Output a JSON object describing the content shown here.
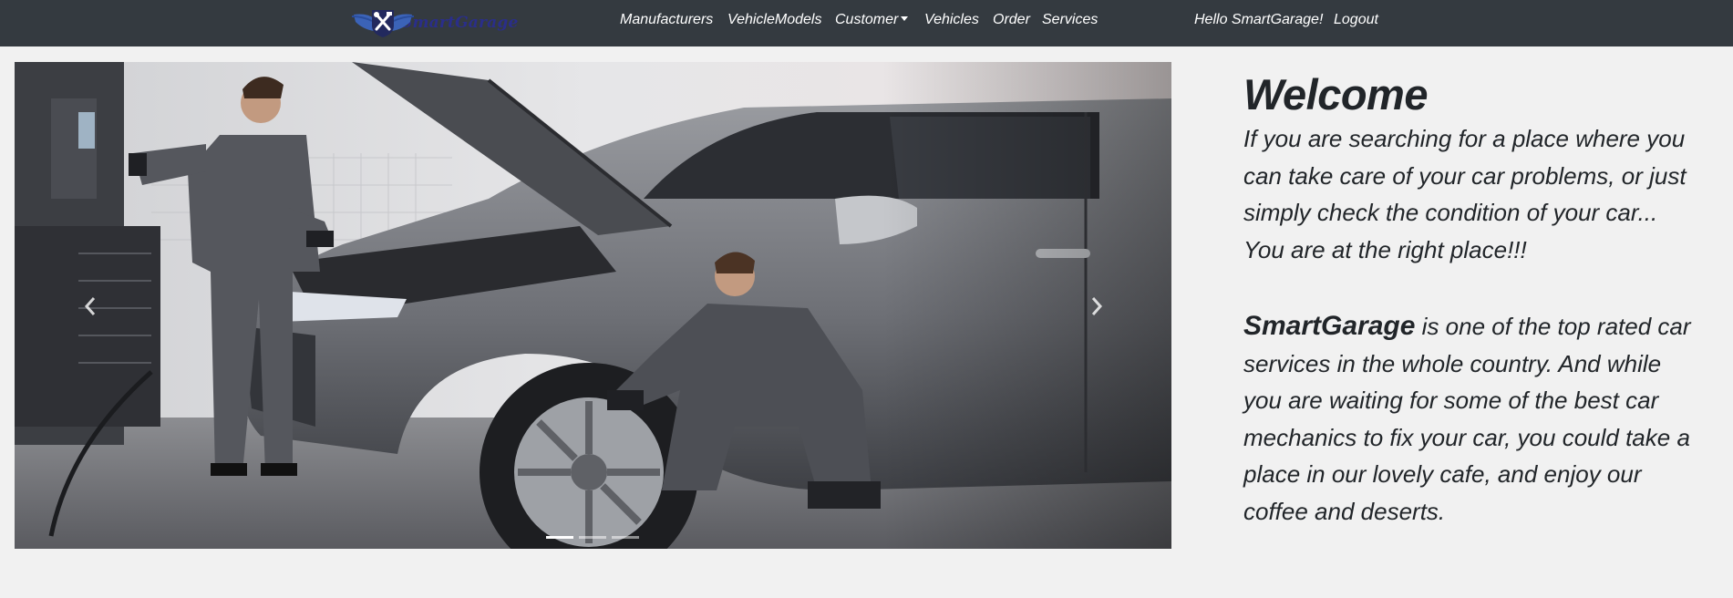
{
  "navbar": {
    "brand": "SmartGarage",
    "brand_icon": "wrench-hammer-shield-icon",
    "links": [
      "Manufacturers",
      "VehicleModels",
      "Customer",
      "Vehicles",
      "Order",
      "Services"
    ],
    "greeting": "Hello SmartGarage!",
    "logout": "Logout"
  },
  "carousel": {
    "prev_icon": "chevron-left-icon",
    "next_icon": "chevron-right-icon",
    "slide_count": 3,
    "active_index": 0
  },
  "welcome": {
    "title": "Welcome",
    "paragraph1": "If you are searching for a place where you can take care of your car problems, or just simply check the condition of your car... You are at the right place!!!",
    "brand_name": "SmartGarage",
    "paragraph2_rest": " is one of the top rated car services in the whole country. And while you are waiting for some of the best car mechanics to fix your car, you could take a place in our lovely cafe, and enjoy our coffee and deserts."
  },
  "colors": {
    "navbar_bg": "#343a40",
    "page_bg": "#f1f1f1",
    "brand_text": "#2a2e8a",
    "brand_wings": "#3b63b8"
  }
}
